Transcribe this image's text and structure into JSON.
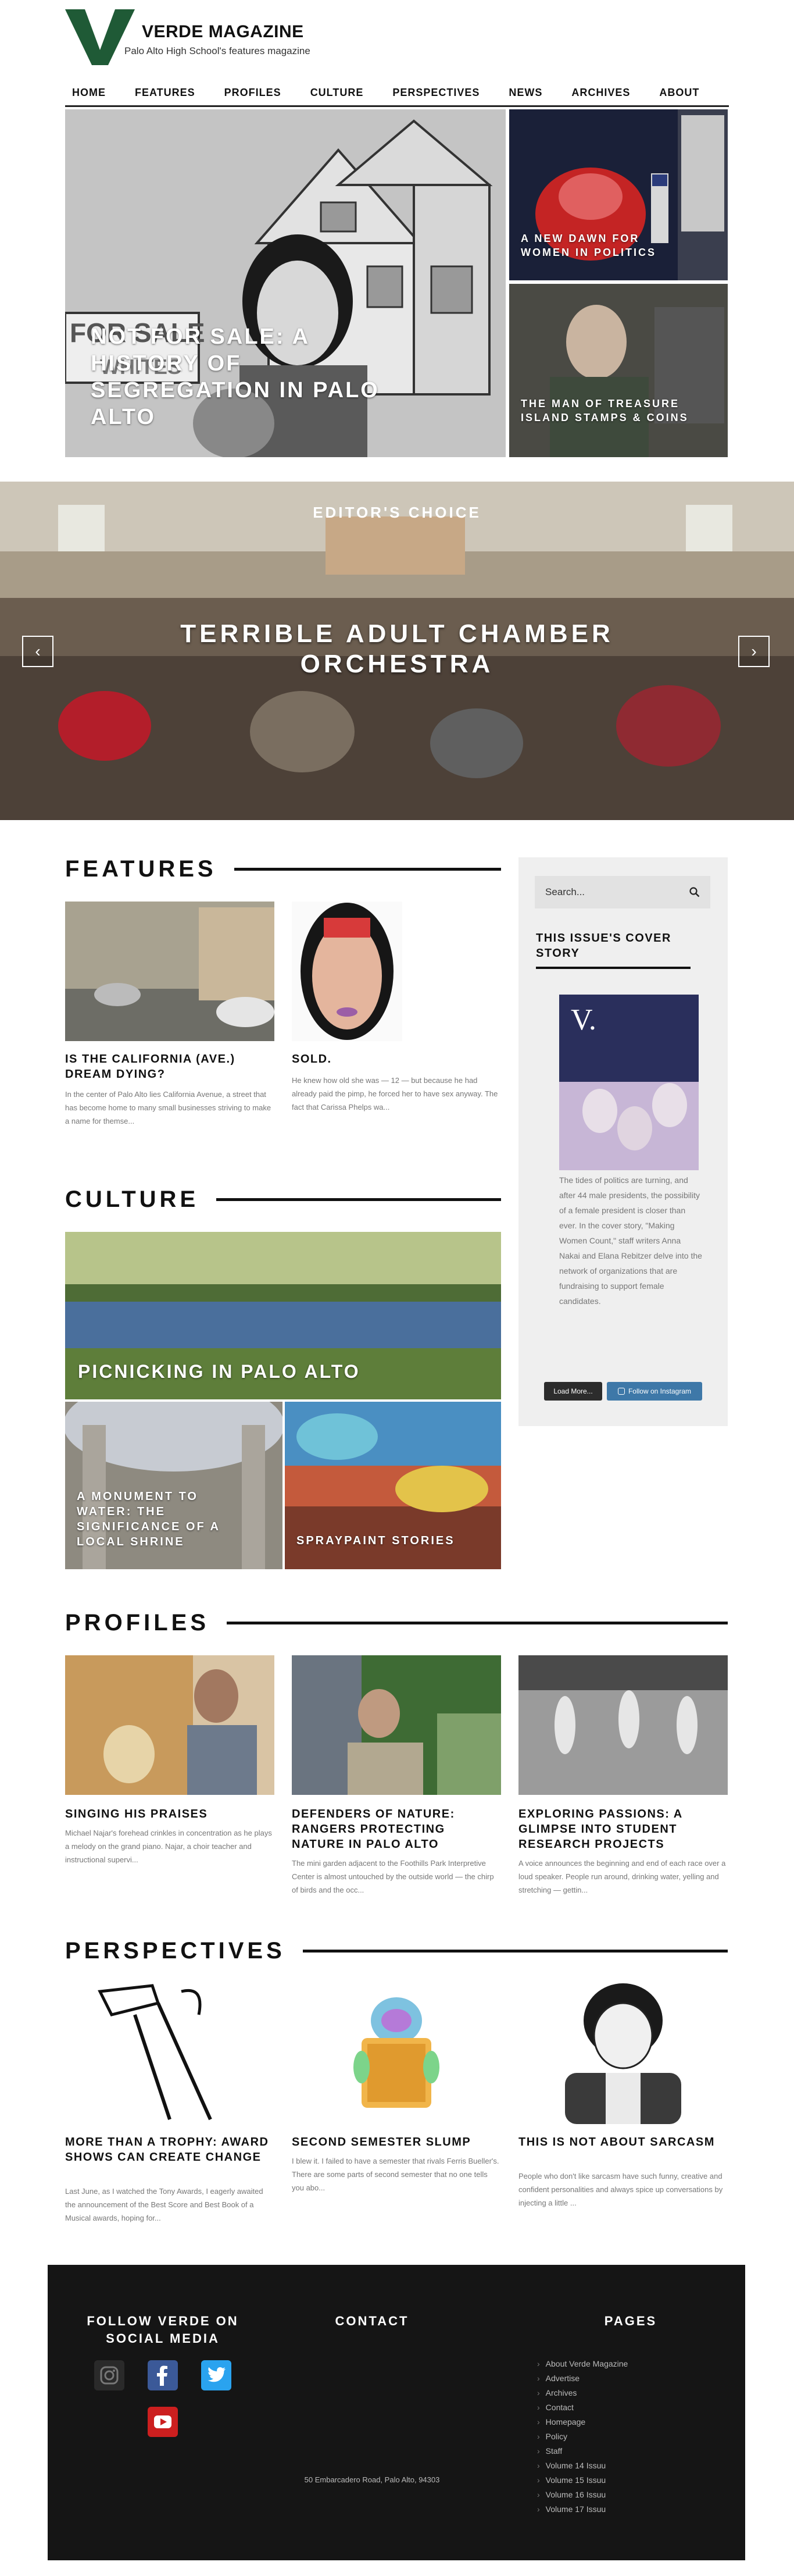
{
  "header": {
    "brand": "VERDE MAGAZINE",
    "tagline": "Palo Alto High School's features magazine",
    "accent": "#1f5a36"
  },
  "nav": [
    "HOME",
    "FEATURES",
    "PROFILES",
    "CULTURE",
    "PERSPECTIVES",
    "NEWS",
    "ARCHIVES",
    "ABOUT"
  ],
  "hero": {
    "main_title": "NOT FOR SALE: A HISTORY OF SEGREGATION IN PALO ALTO",
    "top_right_title": "A NEW DAWN FOR WOMEN IN POLITICS",
    "bottom_right_title": "THE MAN OF TREASURE ISLAND STAMPS & COINS",
    "sign_text": "FOR SALE",
    "sign_text2": "WHITES"
  },
  "editors_choice": {
    "label": "EDITOR'S CHOICE",
    "title": "TERRIBLE ADULT CHAMBER ORCHESTRA",
    "prev": "‹",
    "next": "›"
  },
  "features": {
    "heading": "FEATURES",
    "cards": [
      {
        "title": "IS THE CALIFORNIA (AVE.) DREAM DYING?",
        "excerpt": "In the center of Palo Alto lies California Avenue, a street that has become home to many small businesses striving to make a name for themse..."
      },
      {
        "title": "SOLD.",
        "excerpt": "He knew how old she was — 12 — but because he had already paid the pimp, he forced her to have sex anyway. The fact that Carissa Phelps wa..."
      }
    ]
  },
  "sidebar": {
    "search_placeholder": "Search...",
    "cover_heading": "THIS ISSUE'S COVER STORY",
    "cover_letter": "V.",
    "cover_text": "The tides of politics are turning, and after 44 male presidents, the possibility of a female president is closer than ever. In the cover story, \"Making Women Count,\" staff writers Anna Nakai and Elana Rebitzer delve into the network of organizations that are fundraising to support female candidates.",
    "load_more": "Load More...",
    "follow_instagram": "Follow on Instagram"
  },
  "culture": {
    "heading": "CULTURE",
    "main_title": "PICNICKING IN PALO ALTO",
    "left_title": "A MONUMENT TO WATER: THE SIGNIFICANCE OF A LOCAL SHRINE",
    "right_title": "SPRAYPAINT STORIES"
  },
  "profiles": {
    "heading": "PROFILES",
    "cards": [
      {
        "title": "SINGING HIS PRAISES",
        "excerpt": "Michael Najar's forehead crinkles in concentration as he plays a melody on the grand piano. Najar, a choir teacher and instructional supervi..."
      },
      {
        "title": "DEFENDERS OF NATURE: RANGERS PROTECTING NATURE IN PALO ALTO",
        "excerpt": "The mini garden adjacent to the Foothills Park Interpretive Center is almost untouched by the outside world — the chirp of birds and the occ..."
      },
      {
        "title": "EXPLORING PASSIONS: A GLIMPSE INTO STUDENT RESEARCH PROJECTS",
        "excerpt": "A voice announces the beginning and end of each race over a loud speaker. People run around, drinking water, yelling and stretching — gettin..."
      }
    ]
  },
  "perspectives": {
    "heading": "PERSPECTIVES",
    "cards": [
      {
        "title": "MORE THAN A TROPHY: AWARD SHOWS CAN CREATE CHANGE",
        "excerpt": "Last June, as I watched the Tony Awards, I eagerly awaited the announcement of the Best Score and Best Book of a Musical awards, hoping for..."
      },
      {
        "title": "SECOND SEMESTER SLUMP",
        "excerpt": "I blew it. I failed to have a semester that rivals Ferris Bueller's. There are some parts of second semester that no one tells you abo..."
      },
      {
        "title": "THIS IS NOT ABOUT SARCASM",
        "excerpt": "People who don't like sarcasm have such funny, creative and confident personalities and always spice up conversations by injecting a little ..."
      }
    ]
  },
  "footer": {
    "social_heading": "FOLLOW VERDE ON SOCIAL MEDIA",
    "contact_heading": "CONTACT",
    "pages_heading": "PAGES",
    "address": "50 Embarcadero Road, Palo Alto, 94303",
    "pages": [
      "About Verde Magazine",
      "Advertise",
      "Archives",
      "Contact",
      "Homepage",
      "Policy",
      "Staff",
      "Volume 14 Issuu",
      "Volume 15 Issuu",
      "Volume 16 Issuu",
      "Volume 17 Issuu"
    ],
    "social_icons": [
      "instagram-icon",
      "facebook-icon",
      "twitter-icon",
      "youtube-icon"
    ]
  }
}
